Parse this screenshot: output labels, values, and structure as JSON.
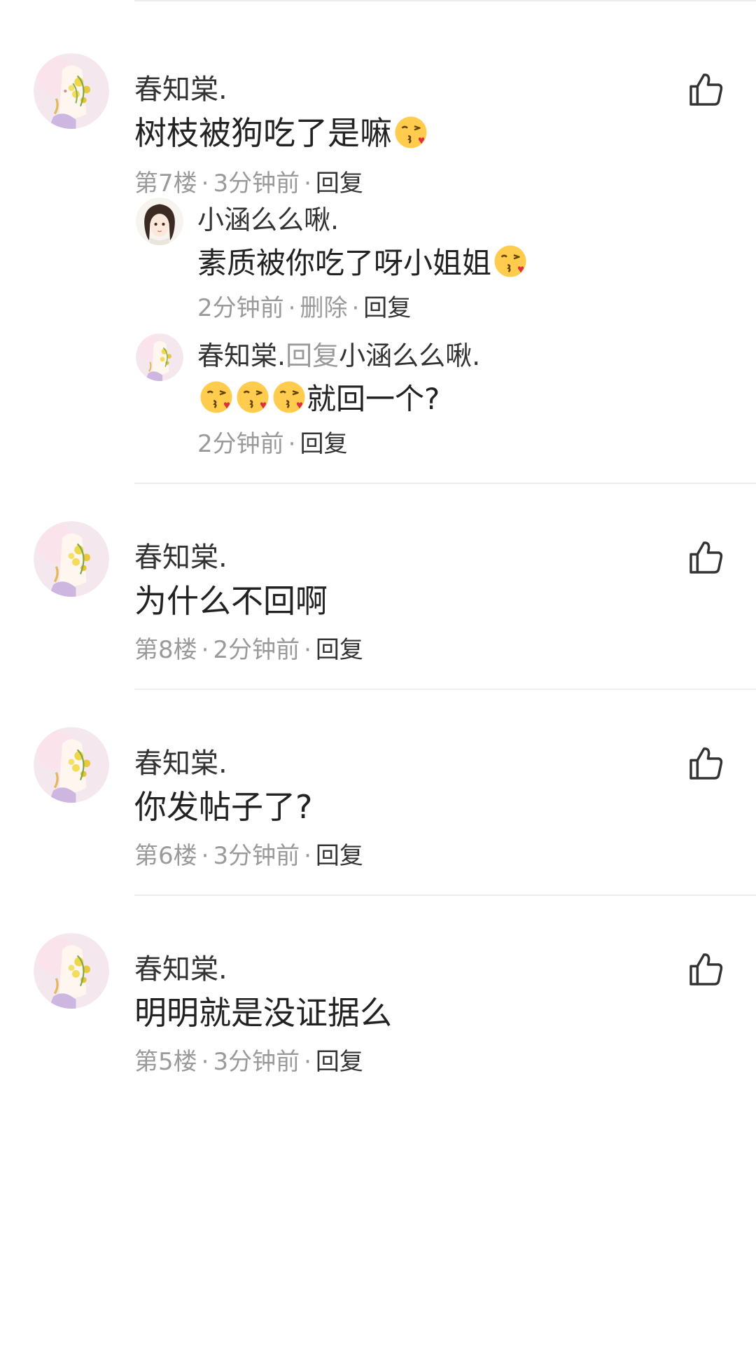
{
  "comments": [
    {
      "username": "春知棠.",
      "text": "树枝被狗吃了是嘛",
      "floor": "第7楼",
      "time": "3分钟前",
      "reply": "回复",
      "replies": [
        {
          "username": "小涵么么啾.",
          "text": "素质被你吃了呀小姐姐",
          "time": "2分钟前",
          "delete": "删除",
          "reply": "回复"
        },
        {
          "username": "春知棠.",
          "reply_word": "回复",
          "reply_to": "小涵么么啾.",
          "text": "就回一个?",
          "time": "2分钟前",
          "reply": "回复"
        }
      ]
    },
    {
      "username": "春知棠.",
      "text": "为什么不回啊",
      "floor": "第8楼",
      "time": "2分钟前",
      "reply": "回复"
    },
    {
      "username": "春知棠.",
      "text": "你发帖子了?",
      "floor": "第6楼",
      "time": "3分钟前",
      "reply": "回复"
    },
    {
      "username": "春知棠.",
      "text": "明明就是没证据么",
      "floor": "第5楼",
      "time": "3分钟前",
      "reply": "回复"
    }
  ],
  "separator": "·",
  "icons": {
    "like": "thumbs-up-icon",
    "emoji": "face-blowing-kiss-emoji"
  },
  "colors": {
    "meta_gray": "#9a9a9a",
    "text_dark": "#222222",
    "divider": "#ececec"
  }
}
